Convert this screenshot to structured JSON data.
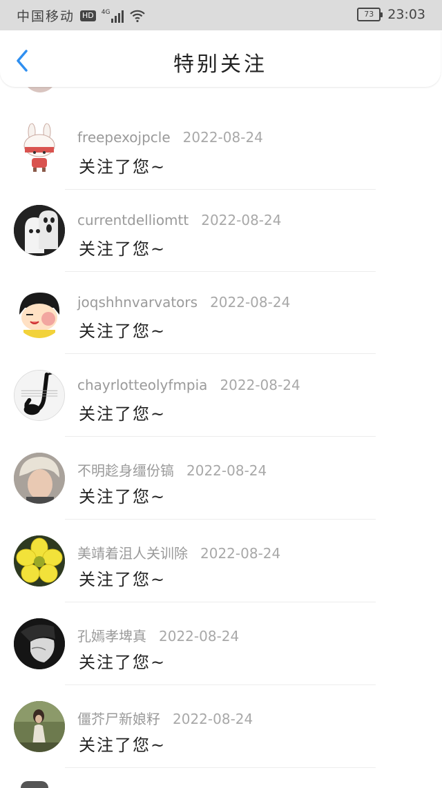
{
  "status_bar": {
    "carrier": "中国移动",
    "hd_badge": "HD",
    "network": "4G",
    "battery": "73",
    "time": "23:03"
  },
  "nav": {
    "back_icon": "chevron-left-icon",
    "title": "特别关注"
  },
  "accent_color": "#2f8ff0",
  "items": [
    {
      "name": "freepexojpcle",
      "date": "2022-08-24",
      "message": "关注了您~",
      "avatar": "bunny-girl-avatar"
    },
    {
      "name": "currentdelliomtt",
      "date": "2022-08-24",
      "message": "关注了您~",
      "avatar": "ghosts-avatar"
    },
    {
      "name": "joqshhnvarvators",
      "date": "2022-08-24",
      "message": "关注了您~",
      "avatar": "cartoon-girl-avatar"
    },
    {
      "name": "chayrlotteolyfmpia",
      "date": "2022-08-24",
      "message": "关注了您~",
      "avatar": "saxophone-avatar"
    },
    {
      "name": "不明趁身缰份镐",
      "date": "2022-08-24",
      "message": "关注了您~",
      "avatar": "blond-man-avatar"
    },
    {
      "name": "美靖着沮人关训除",
      "date": "2022-08-24",
      "message": "关注了您~",
      "avatar": "yellow-flower-avatar"
    },
    {
      "name": "孔嫣孝埤真",
      "date": "2022-08-24",
      "message": "关注了您~",
      "avatar": "bw-portrait-avatar"
    },
    {
      "name": "僵芥尸新娘籽",
      "date": "2022-08-24",
      "message": "关注了您~",
      "avatar": "woman-outdoor-avatar"
    }
  ]
}
